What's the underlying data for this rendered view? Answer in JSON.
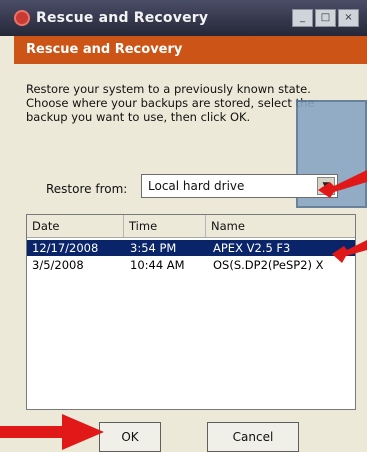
{
  "window": {
    "title": "Rescue and Recovery",
    "controls": [
      "_",
      "□",
      "×"
    ]
  },
  "header": {
    "title": "Rescue and Recovery"
  },
  "instructions": "Restore your system to a previously known state. Choose where your backups are stored, select the backup you want to use, then click OK.",
  "restore_from": {
    "label": "Restore from:",
    "value": "Local hard drive"
  },
  "table": {
    "columns": [
      "Date",
      "Time",
      "Name"
    ],
    "rows": [
      {
        "date": "12/17/2008",
        "time": "3:54 PM",
        "name": "APEX V2.5 F3",
        "selected": true
      },
      {
        "date": "3/5/2008",
        "time": "10:44 AM",
        "name": "OS(S.DP2(PeSP2) X",
        "selected": false
      }
    ]
  },
  "buttons": {
    "ok": "OK",
    "cancel": "Cancel"
  },
  "colors": {
    "header": "#cc5416",
    "selection": "#0a246a",
    "annotation_arrow": "#e01818"
  }
}
